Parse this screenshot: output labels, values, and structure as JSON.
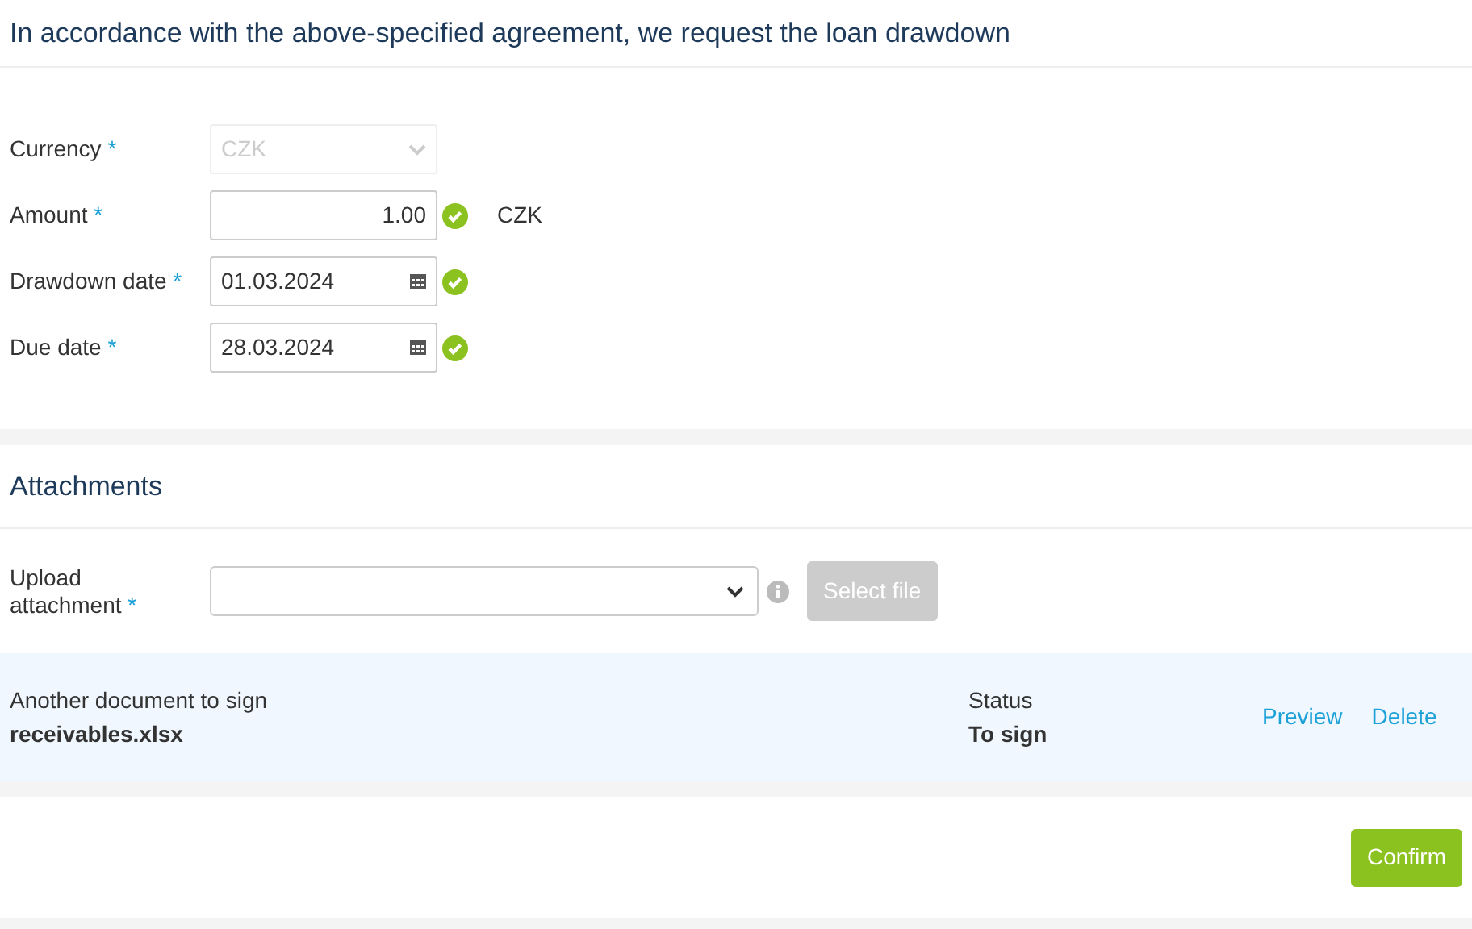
{
  "title": "In accordance with the above-specified agreement, we request the loan drawdown",
  "fields": [
    {
      "kind": "select",
      "label": "Currency",
      "required_mark": "*",
      "value": "CZK",
      "disabled": true,
      "valid": false
    },
    {
      "kind": "number",
      "label": "Amount",
      "required_mark": "*",
      "value": "1.00",
      "disabled": false,
      "valid": true,
      "suffix": "CZK"
    },
    {
      "kind": "date",
      "label": "Drawdown date",
      "required_mark": "*",
      "value": "01.03.2024",
      "disabled": false,
      "valid": true
    },
    {
      "kind": "date",
      "label": "Due date",
      "required_mark": "*",
      "value": "28.03.2024",
      "disabled": false,
      "valid": true
    }
  ],
  "attachments": {
    "title": "Attachments",
    "upload_label": "Upload attachment",
    "upload_required_mark": "*",
    "select_file_button": {
      "label": "Select file",
      "disabled": true
    },
    "documents": [
      {
        "type": "Another document to sign",
        "file": "receivables.xlsx",
        "status_label": "Status",
        "status": "To sign",
        "actions": [
          "Preview",
          "Delete"
        ]
      }
    ]
  },
  "confirm_button": "Confirm"
}
